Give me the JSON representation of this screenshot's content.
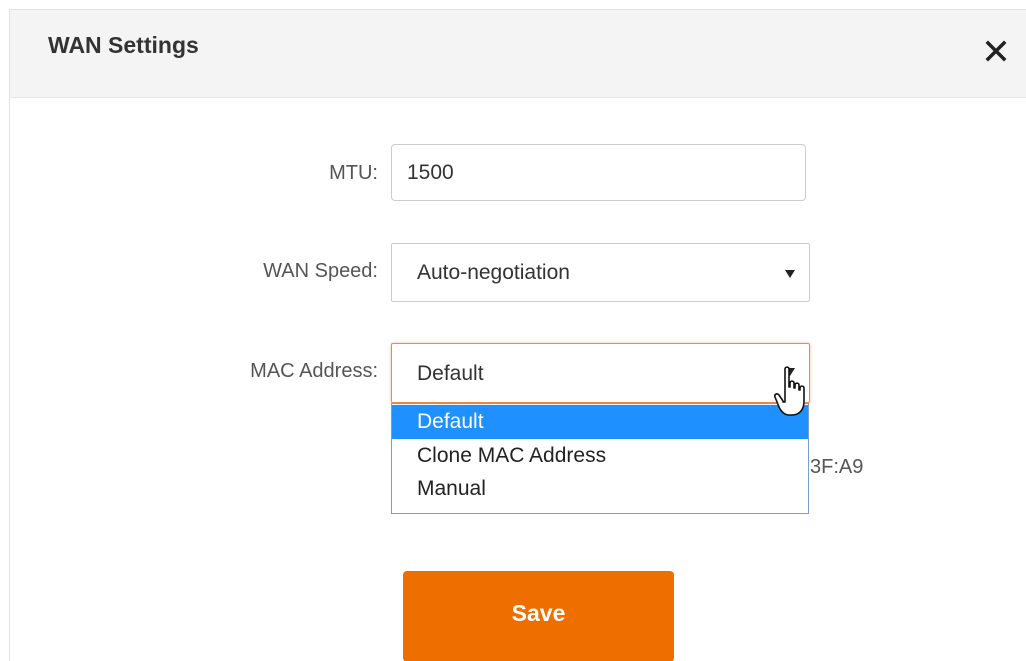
{
  "dialog": {
    "title": "WAN Settings",
    "close_icon": "close-icon"
  },
  "form": {
    "mtu": {
      "label": "MTU:",
      "value": "1500"
    },
    "wan_speed": {
      "label": "WAN Speed:",
      "value": "Auto-negotiation"
    },
    "mac_address": {
      "label": "MAC Address:",
      "value": "Default",
      "options": [
        "Default",
        "Clone MAC Address",
        "Manual"
      ],
      "selected_index": 0,
      "partial_mac_text": "3F:A9"
    }
  },
  "actions": {
    "save_label": "Save"
  },
  "colors": {
    "accent": "#ee6f00",
    "option_highlight": "#1e90ff",
    "focus_border": "#f08a4b"
  }
}
